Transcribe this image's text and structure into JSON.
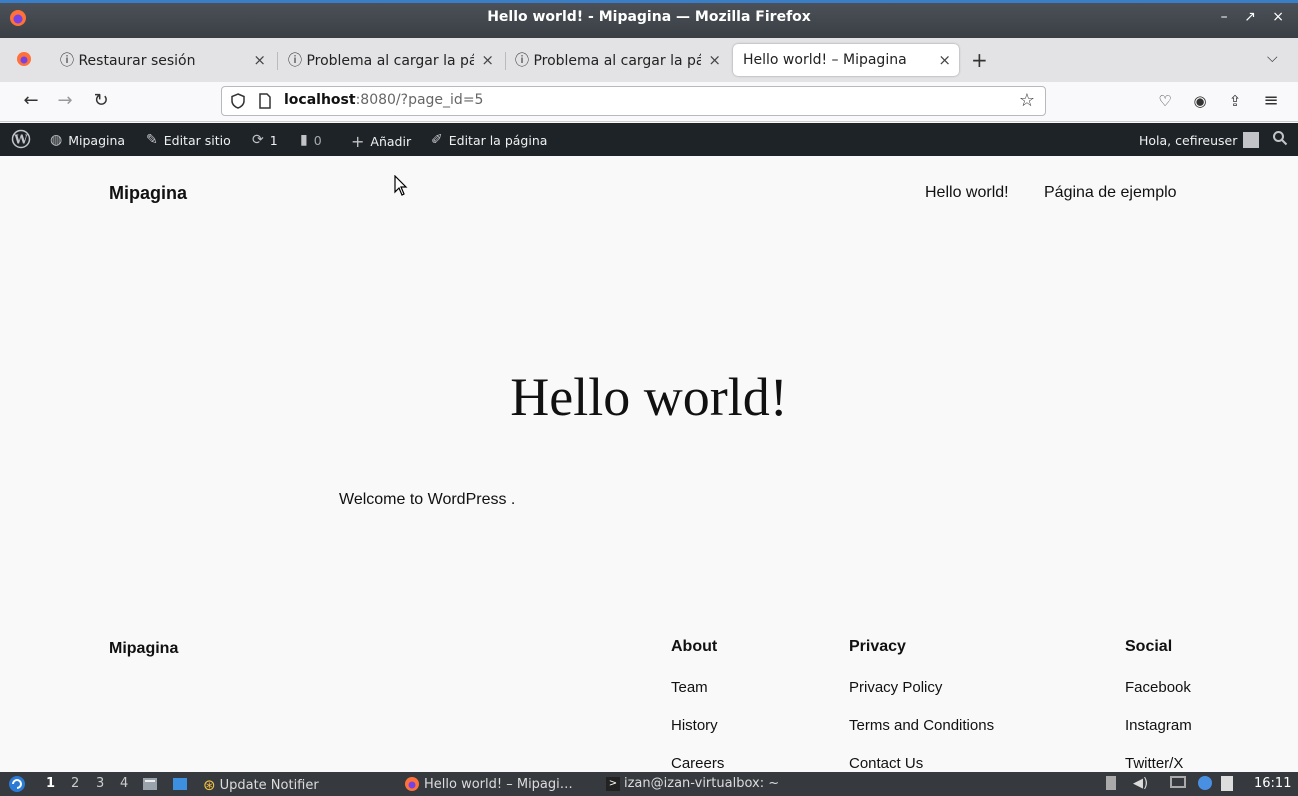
{
  "window": {
    "title": "Hello world! - Mipagina — Mozilla Firefox",
    "controls": "– ↗ ×"
  },
  "tabs": [
    {
      "label": "ⓘ Restaurar sesión",
      "close": "×"
    },
    {
      "label": "ⓘ Problema al cargar la pá",
      "close": "×"
    },
    {
      "label": "ⓘ Problema al cargar la pá",
      "close": "×"
    },
    {
      "label": "Hello world! – Mipagina",
      "close": "×",
      "active": true
    }
  ],
  "tab_new": "+",
  "tab_list": "⌵",
  "nav": {
    "back": "←",
    "forward": "→",
    "reload": "↻",
    "url_host": "localhost",
    "url_rest": ":8080/?page_id=5",
    "bookmark": "☆",
    "pocket": "♡",
    "account": "◉",
    "extensions": "⇪",
    "menu": "≡"
  },
  "admin_bar": {
    "site": "Mipagina",
    "edit_site": "Editar sitio",
    "updates": "1",
    "comments": "0",
    "add": "Añadir",
    "edit_page": "Editar la página",
    "greeting": "Hola, cefireuser"
  },
  "site": {
    "title": "Mipagina",
    "nav": [
      "Hello world!",
      "Página de ejemplo"
    ]
  },
  "post": {
    "title": "Hello world!",
    "body": "Welcome to WordPress ."
  },
  "footer": {
    "brand": "Mipagina",
    "columns": [
      {
        "heading": "About",
        "links": [
          "Team",
          "History",
          "Careers"
        ]
      },
      {
        "heading": "Privacy",
        "links": [
          "Privacy Policy",
          "Terms and Conditions",
          "Contact Us"
        ]
      },
      {
        "heading": "Social",
        "links": [
          "Facebook",
          "Instagram",
          "Twitter/X"
        ]
      }
    ]
  },
  "taskbar": {
    "workspaces": [
      "1",
      "2",
      "3",
      "4"
    ],
    "tasks": [
      "Update Notifier",
      "Hello world! – Mipagi…",
      "izan@izan-virtualbox: ~"
    ],
    "clock": "16:11"
  },
  "colors": {
    "admin_bar": "#1d2327",
    "page_bg": "#f9f9f9",
    "titlebar": "#3f444a",
    "taskbar": "#36393e"
  }
}
